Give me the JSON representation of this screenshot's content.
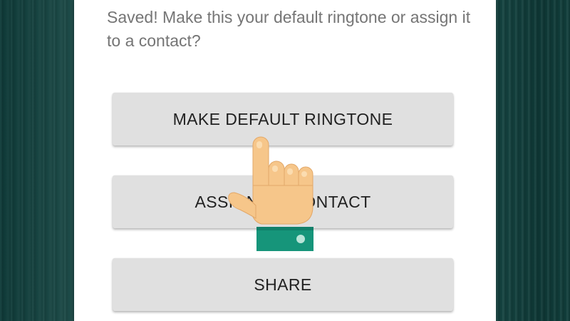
{
  "dialog": {
    "message": "Saved! Make this your default ringtone or assign it to a contact?"
  },
  "buttons": {
    "make_default": "MAKE DEFAULT RINGTONE",
    "assign_contact": "ASSIGN TO CONTACT",
    "share": "SHARE"
  },
  "overlay": {
    "pointer": "pointing-hand-icon"
  },
  "colors": {
    "background": "#0f3a38",
    "dialog": "#ffffff",
    "button": "#e0e0e0",
    "button_text": "#212121",
    "message_text": "#757575",
    "hand_skin": "#f6c68a",
    "hand_cuff": "#16957a"
  }
}
